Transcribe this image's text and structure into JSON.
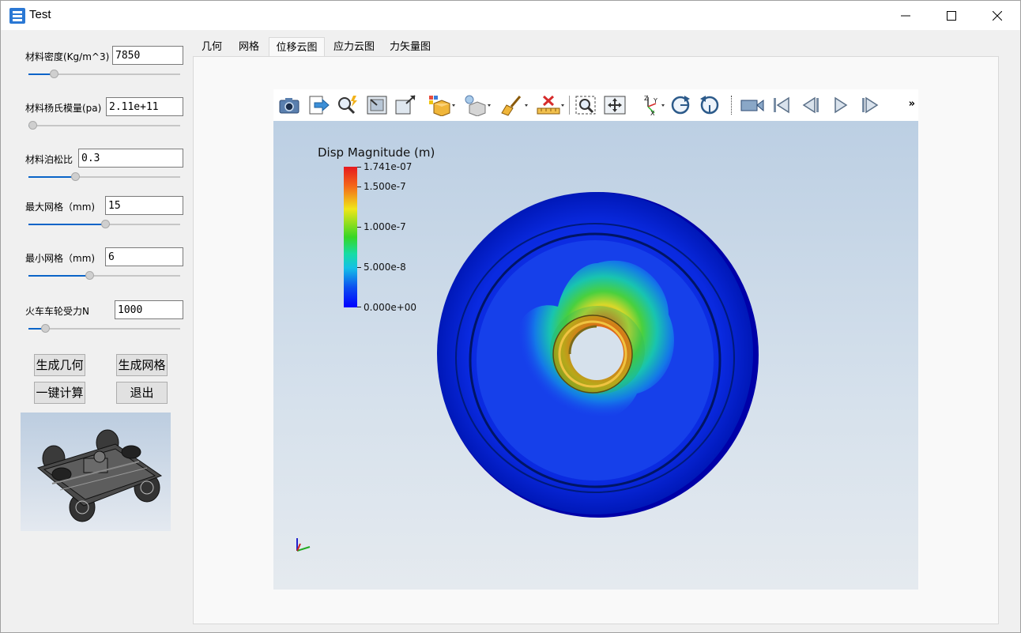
{
  "window": {
    "title": "Test"
  },
  "params": [
    {
      "label": "材料密度(Kg/m^3)",
      "value": "7850",
      "slider": 0.15
    },
    {
      "label": "材料杨氏模量(pa)",
      "value": "2.11e+11",
      "slider": 0.0
    },
    {
      "label": "材料泊松比",
      "value": "0.3",
      "slider": 0.3
    },
    {
      "label": "最大网格（mm)",
      "value": "15",
      "slider": 0.51
    },
    {
      "label": "最小网格（mm)",
      "value": "6",
      "slider": 0.4
    },
    {
      "label": "火车车轮受力N",
      "value": "1000",
      "slider": 0.09
    }
  ],
  "buttons": {
    "gen_geometry": "生成几何",
    "gen_mesh": "生成网格",
    "compute": "一键计算",
    "exit": "退出"
  },
  "tabs": [
    "几何",
    "网格",
    "位移云图",
    "应力云图",
    "力矢量图"
  ],
  "active_tab": "位移云图",
  "toolbar_icons": [
    "camera-icon",
    "export-icon",
    "pick-icon",
    "reset-camera-icon",
    "zoom-to-box-icon",
    "color-by-icon",
    "lighting-icon",
    "paint-icon",
    "ruler-icon",
    "zoom-to-selection-icon",
    "fit-view-icon",
    "axes-orient-icon",
    "rotate-cw-icon",
    "rotate-ccw-icon",
    "video-icon",
    "first-frame-icon",
    "prev-frame-icon",
    "play-icon",
    "last-frame-icon"
  ],
  "toolbar_more": "»",
  "legend": {
    "title": "Disp Magnitude (m)",
    "ticks": [
      "1.741e-07",
      "1.500e-7",
      "1.000e-7",
      "5.000e-8",
      "0.000e+00"
    ]
  }
}
